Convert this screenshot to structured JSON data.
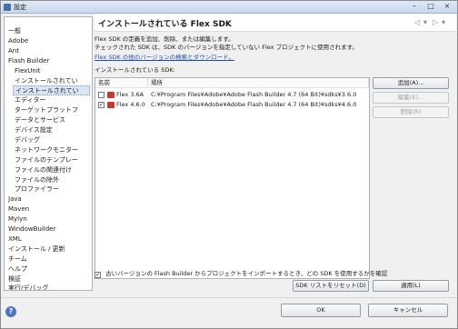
{
  "window": {
    "title": "設定"
  },
  "tree": [
    "一般",
    "Adobe",
    "Ant",
    "Flash Builder",
    "FlexUnit",
    "インストールされてい",
    "インストールされてい",
    "エディター",
    "ターゲットプラットフ",
    "データとサービス",
    "デバイス設定",
    "デバッグ",
    "ネットワークモニター",
    "ファイルのテンプレー",
    "ファイルの関連付け",
    "ファイルの除外",
    "プロファイラー",
    "Java",
    "Maven",
    "Mylyn",
    "WindowBuilder",
    "XML",
    "インストール / 更新",
    "チーム",
    "ヘルプ",
    "検証",
    "実行/デバッグ"
  ],
  "page": {
    "title": "インストールされている Flex SDK",
    "desc1": "Flex SDK の定義を追加、削除、または編集します。",
    "desc2": "チェックされた SDK は、SDK のバージョンを指定していない Flex プロジェクトに使用されます。",
    "link": "Flex SDK の他のバージョンの検索とダウンロード。",
    "list_label": "インストールされている SDK:"
  },
  "table": {
    "col_name": "名前",
    "col_location": "場所",
    "rows": [
      {
        "checked": false,
        "name": "Flex 3.6A",
        "location": "C:¥Program Files¥Adobe¥Adobe Flash Builder 4.7 (64 Bit)¥sdks¥3.6.0"
      },
      {
        "checked": true,
        "name": "Flex 4.6.0",
        "location": "C:¥Program Files¥Adobe¥Adobe Flash Builder 4.7 (64 Bit)¥sdks¥4.6.0"
      }
    ]
  },
  "buttons": {
    "add": "追加(A)...",
    "edit": "編集(E)...",
    "remove": "削除(R)",
    "reset": "SDK リストをリセット(D)",
    "apply": "適用(L)",
    "ok": "OK",
    "cancel": "キャンセル"
  },
  "bottom_checkbox": "古いバージョンの Flash Builder からプロジェクトをインポートするとき、どの SDK を使用するかを確認",
  "bottom_checkbox_checked": true
}
